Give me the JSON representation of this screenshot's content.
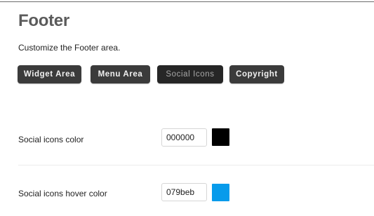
{
  "header": {
    "title": "Footer",
    "subtitle": "Customize the Footer area."
  },
  "tabs": [
    {
      "label": "Widget Area",
      "active": false
    },
    {
      "label": "Menu Area",
      "active": false
    },
    {
      "label": "Social Icons",
      "active": true
    },
    {
      "label": "Copyright",
      "active": false
    }
  ],
  "settings": {
    "social_icons_color": {
      "label": "Social icons color",
      "value": "000000",
      "swatch": "#000000"
    },
    "social_icons_hover_color": {
      "label": "Social icons hover color",
      "value": "079beb",
      "swatch": "#079beb"
    }
  }
}
